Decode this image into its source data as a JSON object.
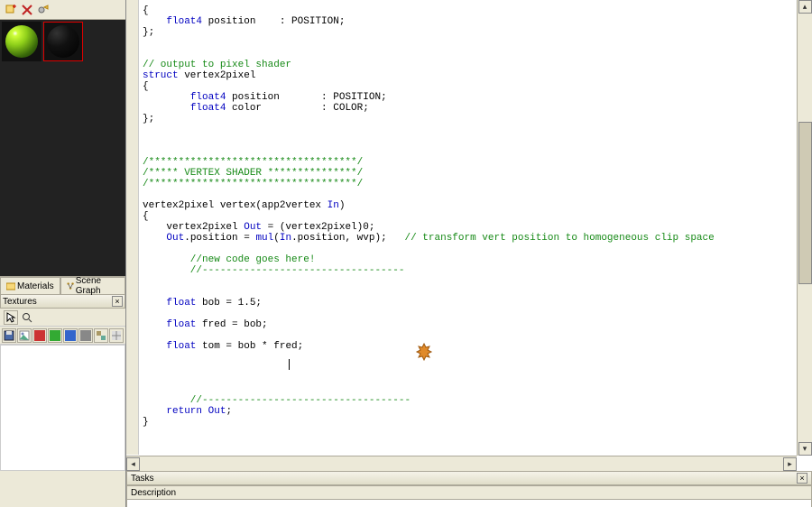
{
  "left": {
    "tabs": {
      "materials": "Materials",
      "scene_graph": "Scene Graph"
    },
    "textures_title": "Textures"
  },
  "tasks": {
    "title": "Tasks",
    "col_description": "Description"
  },
  "code": {
    "l0": "{",
    "l1": "    float4 position    : POSITION;",
    "l2": "};",
    "l3": "",
    "l4": "",
    "l5": "// output to pixel shader",
    "l6": "struct vertex2pixel",
    "l7": "{",
    "l8": "        float4 position       : POSITION;",
    "l9": "        float4 color          : COLOR;",
    "l10": "};",
    "l11": "",
    "l12": "",
    "l13": "",
    "l14": "/***********************************/",
    "l15": "/***** VERTEX SHADER ***************/",
    "l16": "/***********************************/",
    "l17": "",
    "l18": "vertex2pixel vertex(app2vertex In)",
    "l19": "{",
    "l20": "    vertex2pixel Out = (vertex2pixel)0;",
    "l21": "    Out.position = mul(In.position, wvp);   // transform vert position to homogeneous clip space",
    "l22": "",
    "l23": "    //new code goes here!",
    "l24": "    //----------------------------------",
    "l25": "",
    "l26": "",
    "l27": "    float bob = 1.5;",
    "l28": "",
    "l29": "    float fred = bob;",
    "l30": "",
    "l31": "    float tom = bob * fred;",
    "l32": "",
    "l33": "    ",
    "l34": "",
    "l35": "",
    "l36": "    //-----------------------------------",
    "l37": "    return Out;",
    "l38": "}"
  }
}
